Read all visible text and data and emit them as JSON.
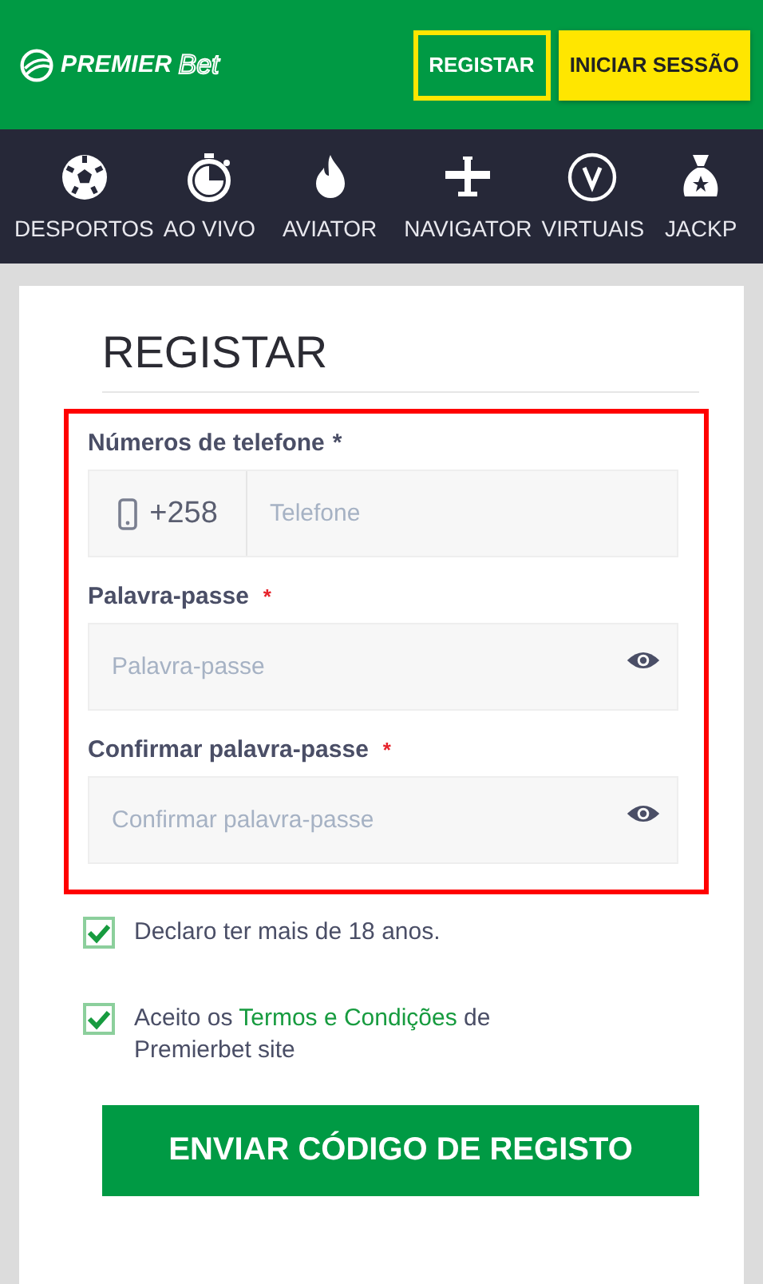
{
  "header": {
    "logo": {
      "word": "PREMIER",
      "suffix": "Bet"
    },
    "buttons": [
      {
        "label": "REGISTAR",
        "kind": "outline"
      },
      {
        "label": "INICIAR SESSÃO",
        "kind": "solid"
      }
    ]
  },
  "nav": [
    {
      "label": "DESPORTOS",
      "kind": "ball"
    },
    {
      "label": "AO VIVO",
      "kind": "stopwatch"
    },
    {
      "label": "AVIATOR",
      "kind": "flame"
    },
    {
      "label": "NAVIGATOR",
      "kind": "plane"
    },
    {
      "label": "VIRTUAIS",
      "kind": "v"
    },
    {
      "label": "JACKP",
      "kind": "bag"
    }
  ],
  "form": {
    "title": "REGISTAR",
    "fields": [
      {
        "kind": "phone",
        "label": "Números de telefone",
        "required": "*",
        "prefix": "+258",
        "placeholder": "Telefone"
      },
      {
        "kind": "password",
        "label": "Palavra-passe",
        "required": "*",
        "placeholder": "Palavra-passe"
      },
      {
        "kind": "password",
        "label": "Confirmar palavra-passe",
        "required": "*",
        "placeholder": "Confirmar palavra-passe"
      }
    ],
    "checkboxes": [
      {
        "checked": true,
        "text": "Declaro ter mais de 18 anos."
      },
      {
        "checked": true,
        "text": "Aceito os ",
        "link": "Termos e Condições",
        "after": " de Premierbet site"
      }
    ],
    "submit": "ENVIAR CÓDIGO DE REGISTO"
  }
}
